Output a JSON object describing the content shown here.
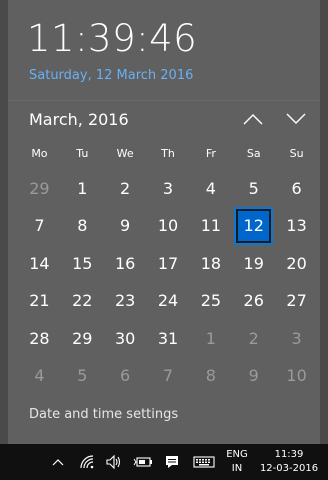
{
  "clock": {
    "time": "11:39:46",
    "date_long": "Saturday, 12 March 2016"
  },
  "calendar": {
    "month_label": "March, 2016",
    "weekdays": [
      "Mo",
      "Tu",
      "We",
      "Th",
      "Fr",
      "Sa",
      "Su"
    ],
    "weeks": [
      [
        {
          "d": "29",
          "out": true
        },
        {
          "d": "1"
        },
        {
          "d": "2"
        },
        {
          "d": "3"
        },
        {
          "d": "4"
        },
        {
          "d": "5"
        },
        {
          "d": "6"
        }
      ],
      [
        {
          "d": "7"
        },
        {
          "d": "8"
        },
        {
          "d": "9"
        },
        {
          "d": "10"
        },
        {
          "d": "11"
        },
        {
          "d": "12",
          "today": true
        },
        {
          "d": "13"
        }
      ],
      [
        {
          "d": "14"
        },
        {
          "d": "15"
        },
        {
          "d": "16"
        },
        {
          "d": "17"
        },
        {
          "d": "18"
        },
        {
          "d": "19"
        },
        {
          "d": "20"
        }
      ],
      [
        {
          "d": "21"
        },
        {
          "d": "22"
        },
        {
          "d": "23"
        },
        {
          "d": "24"
        },
        {
          "d": "25"
        },
        {
          "d": "26"
        },
        {
          "d": "27"
        }
      ],
      [
        {
          "d": "28"
        },
        {
          "d": "29"
        },
        {
          "d": "30"
        },
        {
          "d": "31"
        },
        {
          "d": "1",
          "out": true
        },
        {
          "d": "2",
          "out": true
        },
        {
          "d": "3",
          "out": true
        }
      ],
      [
        {
          "d": "4",
          "out": true
        },
        {
          "d": "5",
          "out": true
        },
        {
          "d": "6",
          "out": true
        },
        {
          "d": "7",
          "out": true
        },
        {
          "d": "8",
          "out": true
        },
        {
          "d": "9",
          "out": true
        },
        {
          "d": "10",
          "out": true
        }
      ]
    ],
    "nav_icons": {
      "up": "chevron-up-icon",
      "down": "chevron-down-icon"
    }
  },
  "footer": {
    "settings_link": "Date and time settings"
  },
  "taskbar": {
    "icons": [
      "chevron-up-icon",
      "wifi-icon",
      "volume-icon",
      "battery-icon",
      "action-center-icon",
      "keyboard-icon"
    ],
    "lang_line1": "ENG",
    "lang_line2": "IN",
    "time": "11:39",
    "date": "12-03-2016"
  },
  "colors": {
    "flyout_bg": "#606060",
    "accent": "#0066cc",
    "date_link": "#6ab0f3",
    "taskbar_bg": "#101010"
  }
}
